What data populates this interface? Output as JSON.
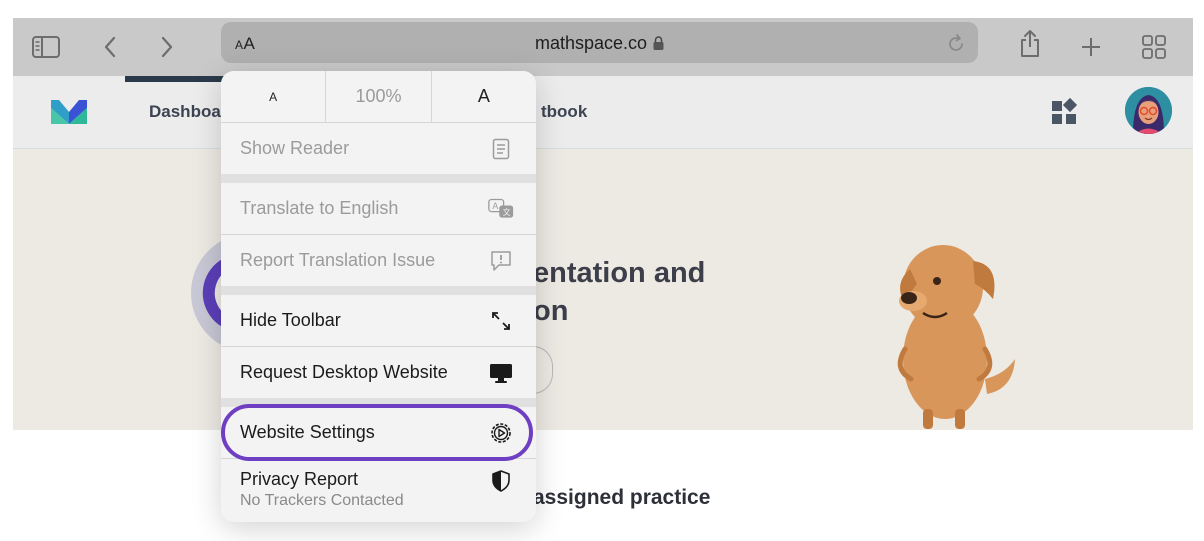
{
  "toolbar": {
    "text_size_button": "AA",
    "domain": "mathspace.co",
    "icons": [
      "sidebar-icon",
      "back-icon",
      "forward-icon",
      "lock-icon",
      "reload-icon",
      "share-icon",
      "new-tab-icon",
      "tabs-overview-icon"
    ]
  },
  "site": {
    "nav": {
      "items": [
        "Dashboa",
        "tbook"
      ]
    },
    "hero": {
      "title_line1": "entation and",
      "title_line2": "on"
    },
    "section_title": "assigned practice"
  },
  "menu": {
    "zoom": {
      "smaller": "A",
      "percent": "100%",
      "larger": "A"
    },
    "items": [
      {
        "label": "Show Reader",
        "icon": "reader-icon",
        "enabled": false
      },
      {
        "label": "Translate to English",
        "icon": "translate-icon",
        "enabled": false
      },
      {
        "label": "Report Translation Issue",
        "icon": "report-issue-icon",
        "enabled": false
      },
      {
        "label": "Hide Toolbar",
        "icon": "expand-arrows-icon",
        "enabled": true
      },
      {
        "label": "Request Desktop Website",
        "icon": "desktop-icon",
        "enabled": true
      },
      {
        "label": "Website Settings",
        "icon": "gear-icon",
        "enabled": true
      },
      {
        "label": "Privacy Report",
        "sublabel": "No Trackers Contacted",
        "icon": "shield-icon",
        "enabled": true
      }
    ]
  },
  "colors": {
    "highlight": "#6e3fc2",
    "brand": "#3a52d4"
  }
}
